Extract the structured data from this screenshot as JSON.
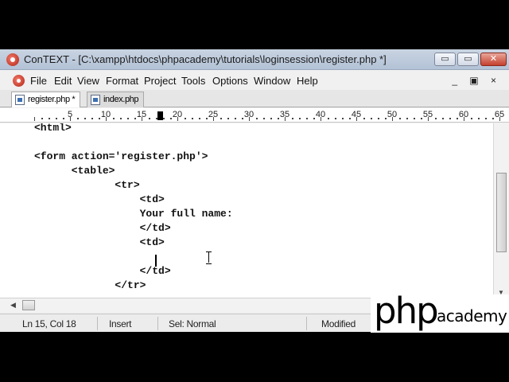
{
  "window": {
    "title": "ConTEXT - [C:\\xampp\\htdocs\\phpacademy\\tutorials\\loginsession\\register.php *]",
    "controls": {
      "minimize": "▭",
      "maximize": "▭",
      "close": "✕"
    }
  },
  "menu": {
    "items": [
      "File",
      "Edit",
      "View",
      "Format",
      "Project",
      "Tools",
      "Options",
      "Window",
      "Help"
    ],
    "mdi_controls": "_ ▣ ×"
  },
  "tabs": [
    {
      "label": "register.php *",
      "active": true
    },
    {
      "label": "index.php",
      "active": false
    }
  ],
  "ruler": {
    "labels": [
      "5",
      "10",
      "15",
      "20",
      "25",
      "30",
      "35",
      "40",
      "45",
      "50",
      "55",
      "60",
      "65"
    ],
    "caret_column": 18
  },
  "editor": {
    "lines": [
      "<html>",
      "",
      "<form action='register.php'>",
      "      <table>",
      "             <tr>",
      "                 <td>",
      "                 Your full name:",
      "                 </td>",
      "                 <td>",
      "                 ",
      "                 </td>",
      "             </tr>"
    ]
  },
  "status": {
    "position": "Ln 15, Col 18",
    "mode": "Insert",
    "selection": "Sel: Normal",
    "modified": "Modified"
  },
  "watermark": {
    "php": "php",
    "academy": "academy"
  },
  "colors": {
    "titlebar": "#b3c2d6",
    "accent": "#c5402d"
  }
}
